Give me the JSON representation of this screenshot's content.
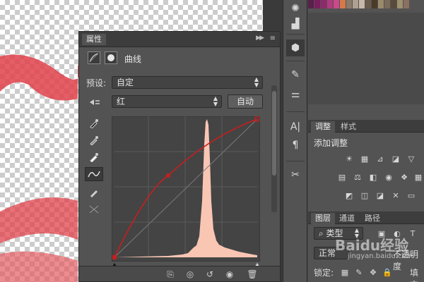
{
  "properties_panel": {
    "tab_label": "属性",
    "collapse_icon": "double-chevron-right-icon",
    "menu_icon": "panel-menu-icon",
    "adjustment_title": "曲线",
    "preset_label": "预设:",
    "preset_value": "自定",
    "channel_value": "红",
    "auto_button": "自动"
  },
  "curve": {
    "points": [
      [
        0,
        0
      ],
      [
        72,
        127
      ],
      [
        255,
        255
      ]
    ],
    "histogram_color": "#f9c6b4",
    "curve_color": "#c81e1e"
  },
  "right_panels": {
    "adjustments_tabs": [
      "调整",
      "样式"
    ],
    "add_adjustment_label": "添加调整",
    "layers_tabs": [
      "图层",
      "通道",
      "路径"
    ],
    "kind_filter": "类型",
    "blend_mode": "正常",
    "opacity_label": "不透明度",
    "lock_label": "锁定:",
    "fill_label": "填充"
  },
  "watermark": {
    "text": "Baidu经验",
    "url": "jingyan.baidu.com"
  },
  "colors": {
    "accent_red": "#c81e1e",
    "panel_bg": "#535353",
    "panel_dark": "#3d3d3d"
  }
}
